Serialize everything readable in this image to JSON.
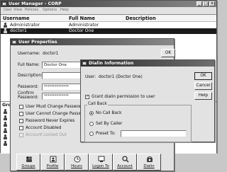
{
  "main": {
    "title": "User Manager - CORP",
    "menu": [
      "User",
      "View",
      "Policies",
      "Options",
      "Help"
    ],
    "columns": {
      "username": "Username",
      "full_name": "Full Name",
      "description": "Description"
    },
    "rows": [
      {
        "username": "Administrator",
        "full_name": "Administrator",
        "description": ""
      },
      {
        "username": "doctor1",
        "full_name": "Doctor One",
        "description": ""
      }
    ],
    "groups_label": "Grou"
  },
  "props": {
    "title": "User Properties",
    "username_label": "Username:",
    "username": "doctor1",
    "fullname_label": "Full Name:",
    "fullname": "Doctor One",
    "description_label": "Description:",
    "description": "",
    "password_label": "Password:",
    "password": "**************",
    "confirm_label_1": "Confirm",
    "confirm_label_2": "Password:",
    "confirm": "**************",
    "ok": "OK",
    "checks": [
      {
        "label": "User Must Change Password at N",
        "checked": false
      },
      {
        "label": "User Cannot Change Password",
        "checked": false
      },
      {
        "label": "Password Never Expires",
        "checked": false
      },
      {
        "label": "Account Disabled",
        "checked": false
      },
      {
        "label": "Account Locked Out",
        "checked": false,
        "disabled": true
      }
    ]
  },
  "dialin": {
    "title": "Dialin Information",
    "user_label": "User:",
    "user_value": "doctor1 (Doctor One)",
    "ok": "OK",
    "cancel": "Cancel",
    "help": "Help",
    "grant_label": "Grant dialin permission to user",
    "grant_checked": true,
    "callback_legend": "Call Back",
    "options": [
      {
        "label": "No Call Back",
        "selected": true
      },
      {
        "label": "Set By Caller",
        "selected": false
      },
      {
        "label": "Preset To:",
        "selected": false
      }
    ],
    "preset_value": ""
  },
  "toolbar": [
    {
      "label": "Groups",
      "icon": "groups-icon"
    },
    {
      "label": "Profile",
      "icon": "profile-icon"
    },
    {
      "label": "Hours",
      "icon": "clock-icon"
    },
    {
      "label": "Logon To",
      "icon": "logon-icon"
    },
    {
      "label": "Account",
      "icon": "account-icon"
    },
    {
      "label": "Dialin",
      "icon": "dialin-icon"
    }
  ]
}
